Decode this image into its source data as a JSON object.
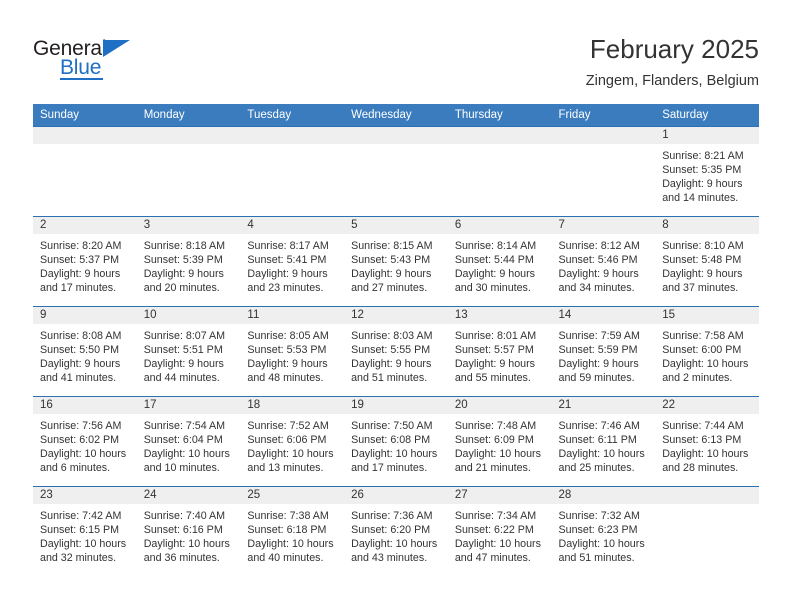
{
  "brand": {
    "name_part1": "General",
    "name_part2": "Blue",
    "logo_icon": "blue-triangle-mark"
  },
  "header": {
    "title": "February 2025",
    "subtitle": "Zingem, Flanders, Belgium"
  },
  "colors": {
    "header_blue": "#3a7cbe",
    "row_rule_blue": "#2c6fb3",
    "daynum_band": "#efefef",
    "brand_blue": "#1f6fc4",
    "text": "#333333"
  },
  "weekdays": [
    "Sunday",
    "Monday",
    "Tuesday",
    "Wednesday",
    "Thursday",
    "Friday",
    "Saturday"
  ],
  "weeks": [
    [
      {
        "day": "",
        "sunrise": "",
        "sunset": "",
        "daylight_1": "",
        "daylight_2": ""
      },
      {
        "day": "",
        "sunrise": "",
        "sunset": "",
        "daylight_1": "",
        "daylight_2": ""
      },
      {
        "day": "",
        "sunrise": "",
        "sunset": "",
        "daylight_1": "",
        "daylight_2": ""
      },
      {
        "day": "",
        "sunrise": "",
        "sunset": "",
        "daylight_1": "",
        "daylight_2": ""
      },
      {
        "day": "",
        "sunrise": "",
        "sunset": "",
        "daylight_1": "",
        "daylight_2": ""
      },
      {
        "day": "",
        "sunrise": "",
        "sunset": "",
        "daylight_1": "",
        "daylight_2": ""
      },
      {
        "day": "1",
        "sunrise": "Sunrise: 8:21 AM",
        "sunset": "Sunset: 5:35 PM",
        "daylight_1": "Daylight: 9 hours",
        "daylight_2": "and 14 minutes."
      }
    ],
    [
      {
        "day": "2",
        "sunrise": "Sunrise: 8:20 AM",
        "sunset": "Sunset: 5:37 PM",
        "daylight_1": "Daylight: 9 hours",
        "daylight_2": "and 17 minutes."
      },
      {
        "day": "3",
        "sunrise": "Sunrise: 8:18 AM",
        "sunset": "Sunset: 5:39 PM",
        "daylight_1": "Daylight: 9 hours",
        "daylight_2": "and 20 minutes."
      },
      {
        "day": "4",
        "sunrise": "Sunrise: 8:17 AM",
        "sunset": "Sunset: 5:41 PM",
        "daylight_1": "Daylight: 9 hours",
        "daylight_2": "and 23 minutes."
      },
      {
        "day": "5",
        "sunrise": "Sunrise: 8:15 AM",
        "sunset": "Sunset: 5:43 PM",
        "daylight_1": "Daylight: 9 hours",
        "daylight_2": "and 27 minutes."
      },
      {
        "day": "6",
        "sunrise": "Sunrise: 8:14 AM",
        "sunset": "Sunset: 5:44 PM",
        "daylight_1": "Daylight: 9 hours",
        "daylight_2": "and 30 minutes."
      },
      {
        "day": "7",
        "sunrise": "Sunrise: 8:12 AM",
        "sunset": "Sunset: 5:46 PM",
        "daylight_1": "Daylight: 9 hours",
        "daylight_2": "and 34 minutes."
      },
      {
        "day": "8",
        "sunrise": "Sunrise: 8:10 AM",
        "sunset": "Sunset: 5:48 PM",
        "daylight_1": "Daylight: 9 hours",
        "daylight_2": "and 37 minutes."
      }
    ],
    [
      {
        "day": "9",
        "sunrise": "Sunrise: 8:08 AM",
        "sunset": "Sunset: 5:50 PM",
        "daylight_1": "Daylight: 9 hours",
        "daylight_2": "and 41 minutes."
      },
      {
        "day": "10",
        "sunrise": "Sunrise: 8:07 AM",
        "sunset": "Sunset: 5:51 PM",
        "daylight_1": "Daylight: 9 hours",
        "daylight_2": "and 44 minutes."
      },
      {
        "day": "11",
        "sunrise": "Sunrise: 8:05 AM",
        "sunset": "Sunset: 5:53 PM",
        "daylight_1": "Daylight: 9 hours",
        "daylight_2": "and 48 minutes."
      },
      {
        "day": "12",
        "sunrise": "Sunrise: 8:03 AM",
        "sunset": "Sunset: 5:55 PM",
        "daylight_1": "Daylight: 9 hours",
        "daylight_2": "and 51 minutes."
      },
      {
        "day": "13",
        "sunrise": "Sunrise: 8:01 AM",
        "sunset": "Sunset: 5:57 PM",
        "daylight_1": "Daylight: 9 hours",
        "daylight_2": "and 55 minutes."
      },
      {
        "day": "14",
        "sunrise": "Sunrise: 7:59 AM",
        "sunset": "Sunset: 5:59 PM",
        "daylight_1": "Daylight: 9 hours",
        "daylight_2": "and 59 minutes."
      },
      {
        "day": "15",
        "sunrise": "Sunrise: 7:58 AM",
        "sunset": "Sunset: 6:00 PM",
        "daylight_1": "Daylight: 10 hours",
        "daylight_2": "and 2 minutes."
      }
    ],
    [
      {
        "day": "16",
        "sunrise": "Sunrise: 7:56 AM",
        "sunset": "Sunset: 6:02 PM",
        "daylight_1": "Daylight: 10 hours",
        "daylight_2": "and 6 minutes."
      },
      {
        "day": "17",
        "sunrise": "Sunrise: 7:54 AM",
        "sunset": "Sunset: 6:04 PM",
        "daylight_1": "Daylight: 10 hours",
        "daylight_2": "and 10 minutes."
      },
      {
        "day": "18",
        "sunrise": "Sunrise: 7:52 AM",
        "sunset": "Sunset: 6:06 PM",
        "daylight_1": "Daylight: 10 hours",
        "daylight_2": "and 13 minutes."
      },
      {
        "day": "19",
        "sunrise": "Sunrise: 7:50 AM",
        "sunset": "Sunset: 6:08 PM",
        "daylight_1": "Daylight: 10 hours",
        "daylight_2": "and 17 minutes."
      },
      {
        "day": "20",
        "sunrise": "Sunrise: 7:48 AM",
        "sunset": "Sunset: 6:09 PM",
        "daylight_1": "Daylight: 10 hours",
        "daylight_2": "and 21 minutes."
      },
      {
        "day": "21",
        "sunrise": "Sunrise: 7:46 AM",
        "sunset": "Sunset: 6:11 PM",
        "daylight_1": "Daylight: 10 hours",
        "daylight_2": "and 25 minutes."
      },
      {
        "day": "22",
        "sunrise": "Sunrise: 7:44 AM",
        "sunset": "Sunset: 6:13 PM",
        "daylight_1": "Daylight: 10 hours",
        "daylight_2": "and 28 minutes."
      }
    ],
    [
      {
        "day": "23",
        "sunrise": "Sunrise: 7:42 AM",
        "sunset": "Sunset: 6:15 PM",
        "daylight_1": "Daylight: 10 hours",
        "daylight_2": "and 32 minutes."
      },
      {
        "day": "24",
        "sunrise": "Sunrise: 7:40 AM",
        "sunset": "Sunset: 6:16 PM",
        "daylight_1": "Daylight: 10 hours",
        "daylight_2": "and 36 minutes."
      },
      {
        "day": "25",
        "sunrise": "Sunrise: 7:38 AM",
        "sunset": "Sunset: 6:18 PM",
        "daylight_1": "Daylight: 10 hours",
        "daylight_2": "and 40 minutes."
      },
      {
        "day": "26",
        "sunrise": "Sunrise: 7:36 AM",
        "sunset": "Sunset: 6:20 PM",
        "daylight_1": "Daylight: 10 hours",
        "daylight_2": "and 43 minutes."
      },
      {
        "day": "27",
        "sunrise": "Sunrise: 7:34 AM",
        "sunset": "Sunset: 6:22 PM",
        "daylight_1": "Daylight: 10 hours",
        "daylight_2": "and 47 minutes."
      },
      {
        "day": "28",
        "sunrise": "Sunrise: 7:32 AM",
        "sunset": "Sunset: 6:23 PM",
        "daylight_1": "Daylight: 10 hours",
        "daylight_2": "and 51 minutes."
      },
      {
        "day": "",
        "sunrise": "",
        "sunset": "",
        "daylight_1": "",
        "daylight_2": ""
      }
    ]
  ]
}
